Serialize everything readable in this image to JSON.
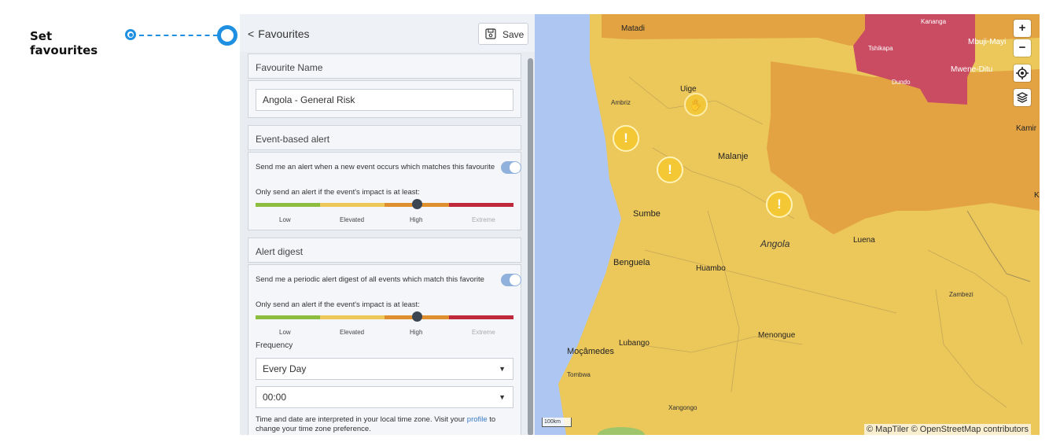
{
  "callout": {
    "label": "Set favourites"
  },
  "panel": {
    "back_label": "Favourites",
    "save_label": "Save",
    "favourite_name": {
      "heading": "Favourite Name",
      "value": "Angola - General Risk"
    },
    "event_alert": {
      "heading": "Event-based alert",
      "toggle_text": "Send me an alert when a new event occurs which matches this favourite",
      "toggle_on": true,
      "impact_text": "Only send an alert if the event's impact is at least:",
      "levels": [
        "Low",
        "Elevated",
        "High",
        "Extreme"
      ],
      "selected_level": "High"
    },
    "digest": {
      "heading": "Alert digest",
      "toggle_text": "Send me a periodic alert digest of all events which match this favorite",
      "toggle_on": true,
      "impact_text": "Only send an alert if the event's impact is at least:",
      "levels": [
        "Low",
        "Elevated",
        "High",
        "Extreme"
      ],
      "selected_level": "High",
      "frequency_label": "Frequency",
      "frequency_value": "Every Day",
      "time_value": "00:00",
      "note_before": "Time and date are interpreted in your local time zone. Visit your ",
      "note_link": "profile",
      "note_after": " to change your time zone preference."
    }
  },
  "map": {
    "places": {
      "matadi": "Matadi",
      "kananga": "Kananga",
      "tshikapa": "Tshikapa",
      "mbuji_mayi": "Mbuji-Mayi",
      "mwene_ditu": "Mwene-Ditu",
      "dundo": "Dundo",
      "uige": "Uige",
      "ambriz": "Ambriz",
      "malanje": "Malanje",
      "sumbe": "Sumbe",
      "angola": "Angola",
      "luena": "Luena",
      "benguela": "Benguela",
      "huambo": "Huambo",
      "zambezi": "Zambezi",
      "menongue": "Menongue",
      "lubango": "Lubango",
      "mocamedes": "Moçâmedes",
      "tombwa": "Tombwa",
      "xangongo": "Xangongo",
      "kamina": "Kamir",
      "k_edge": "K"
    },
    "controls": {
      "zoom_in": "+",
      "zoom_out": "−"
    },
    "scale": "100km",
    "attribution": "© MapTiler © OpenStreetMap contributors",
    "risk_colors": {
      "ocean": "#aec6f2",
      "low_elevated": "#ecc75a",
      "high": "#e3a343",
      "extreme": "#c94c63"
    }
  }
}
